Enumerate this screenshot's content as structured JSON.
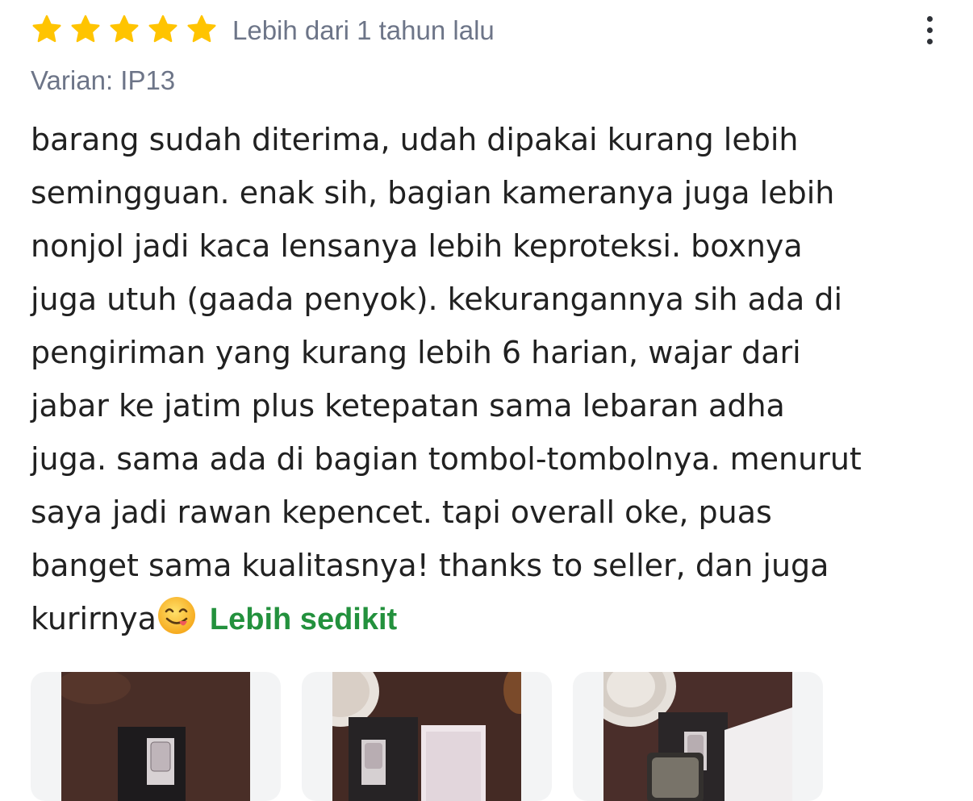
{
  "review": {
    "rating": 5,
    "rating_max": 5,
    "star_color": "#ffc400",
    "date": "Lebih dari 1 tahun lalu",
    "variant": "Varian: IP13",
    "text_lines": [
      "barang sudah diterima, udah dipakai kurang lebih",
      "semingguan. enak sih, bagian kameranya juga lebih",
      "nonjol jadi kaca lensanya lebih keproteksi. boxnya",
      "juga utuh (gaada penyok). kekurangannya sih ada di",
      "pengiriman yang kurang lebih 6 harian, wajar dari",
      "jabar ke jatim plus ketepatan sama lebaran adha",
      "juga. sama ada di bagian tombol-tombolnya. menurut",
      "saya jadi rawan kepencet. tapi overall oke, puas",
      "banget sama kualitasnya! thanks to seller, dan juga",
      "kurirnya"
    ],
    "emoji": "face-savoring-food-icon",
    "show_less": "Lebih sedikit",
    "show_less_color": "#23913d"
  },
  "menu": {
    "icon": "more-vertical-icon"
  },
  "photos": [
    {
      "icon": "photo-thumbnail",
      "subject": "phone case box on wooden table"
    },
    {
      "icon": "photo-thumbnail",
      "subject": "phone case box with plate and bag"
    },
    {
      "icon": "photo-thumbnail",
      "subject": "phone case on table with plate"
    }
  ]
}
